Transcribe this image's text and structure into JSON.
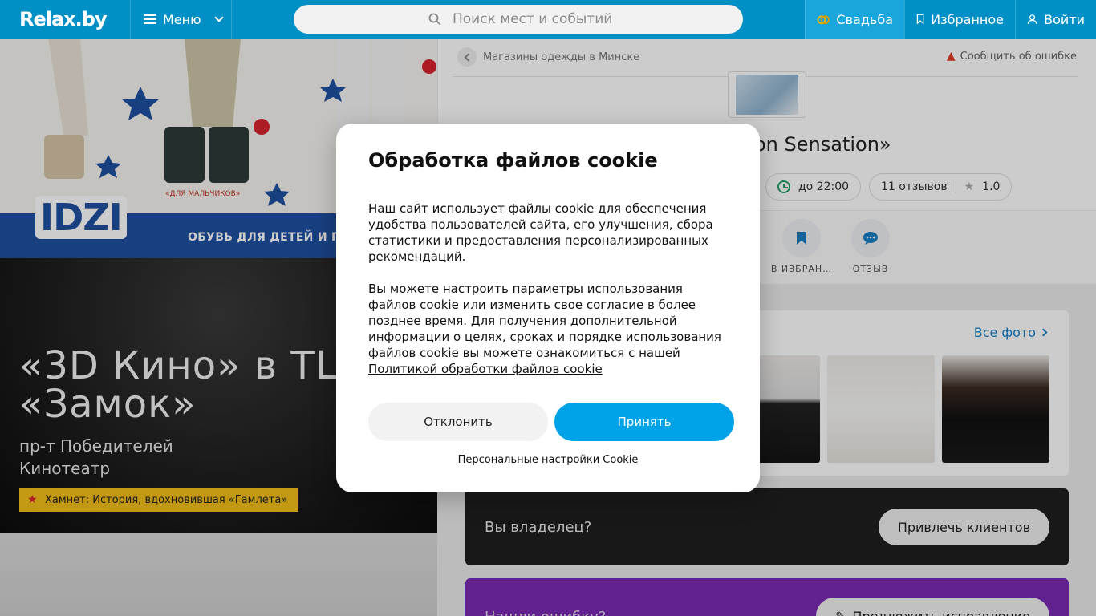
{
  "header": {
    "logo": "Relax.by",
    "menu_label": "Меню",
    "search_placeholder": "Поиск мест и событий",
    "wedding_label": "Свадьба",
    "favorites_label": "Избранное",
    "login_label": "Войти"
  },
  "left": {
    "banner": {
      "brand": "IDZI",
      "sub_boys": "«ДЛЯ МАЛЬЧИКОВ»",
      "strip_text": "ОБУВЬ ДЛЯ ДЕТЕЙ И П"
    },
    "cinema": {
      "title": "«3D Кино» в ТЦ «Замок»",
      "address": "пр-т Победителей",
      "category": "Кинотеатр",
      "tag": "Хамнет: История, вдохновившая «Гамлета»"
    }
  },
  "right": {
    "breadcrumb": "Магазины одежды в Минске",
    "report_error": "Сообщить об ошибке",
    "title_visible": "on Sensation»",
    "hours": "до 22:00",
    "reviews": "11 отзывов",
    "rating": "1.0",
    "actions": [
      {
        "label": "В ИЗБРАН…"
      },
      {
        "label": "ОТЗЫВ"
      }
    ],
    "all_photos": "Все фото",
    "owner_question": "Вы владелец?",
    "owner_button": "Привлечь клиентов",
    "found_error": "Нашли ошибку?",
    "suggest_fix": "Предложить исправление"
  },
  "modal": {
    "title": "Обработка файлов cookie",
    "paragraph1": "Наш сайт использует файлы cookie для обеспечения удобства пользователей сайта, его улучшения, сбора статистики и предоставления персонализированных рекомендаций.",
    "paragraph2": "Вы можете настроить параметры использования файлов cookie или изменить свое согласие в более позднее время. Для получения дополнительной информации о целях, сроках и порядке использования файлов cookie вы можете ознакомиться с нашей",
    "policy_link": "Политикой обработки файлов cookie",
    "decline": "Отклонить",
    "accept": "Принять",
    "settings_link": "Персональные настройки Cookie"
  },
  "colors": {
    "header": "#0090c6",
    "accent": "#00a2e8",
    "banner_blue": "#1f4f9f",
    "tag_yellow": "#f4c01a"
  }
}
